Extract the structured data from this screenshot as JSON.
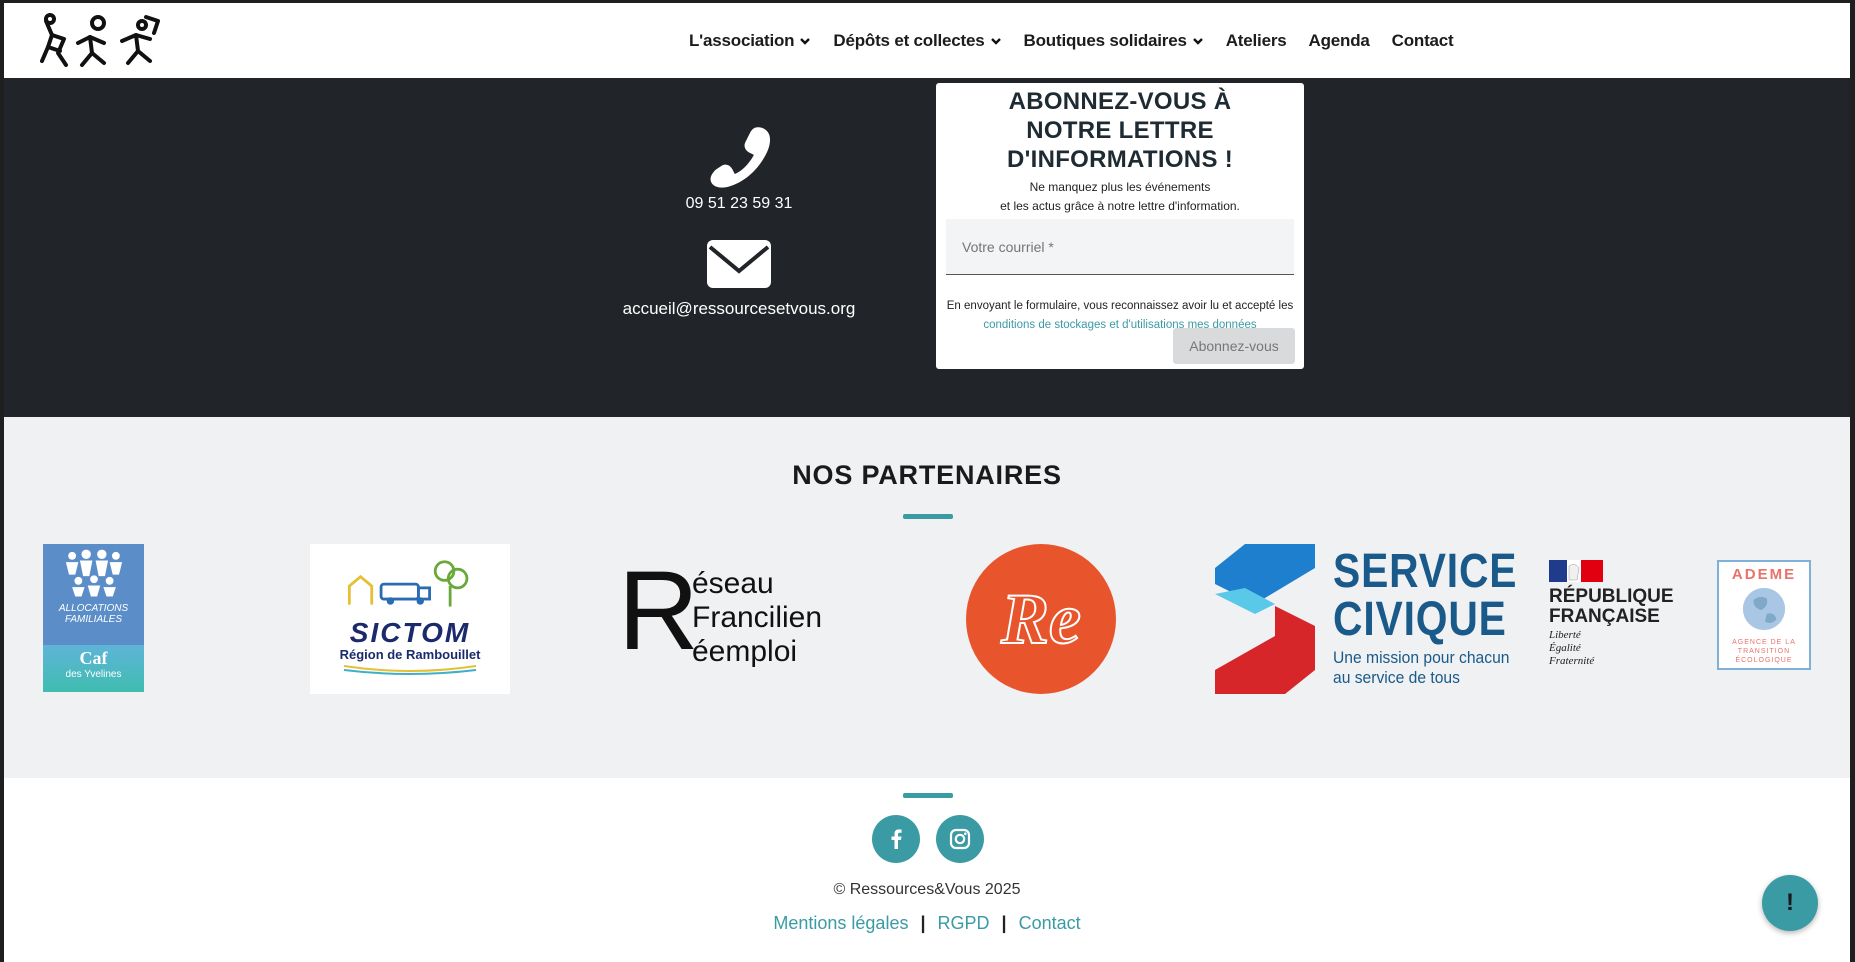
{
  "header": {
    "nav": [
      {
        "label": "L'association",
        "dropdown": true
      },
      {
        "label": "Dépôts et collectes",
        "dropdown": true
      },
      {
        "label": "Boutiques solidaires",
        "dropdown": true
      },
      {
        "label": "Ateliers",
        "dropdown": false
      },
      {
        "label": "Agenda",
        "dropdown": false
      },
      {
        "label": "Contact",
        "dropdown": false
      }
    ]
  },
  "contact": {
    "phone": "09 51 23 59 31",
    "email": "accueil@ressourcesetvous.org"
  },
  "newsletter": {
    "title": "ABONNEZ-VOUS À NOTRE LETTRE D'INFORMATIONS !",
    "subtitle_line1": "Ne manquez plus les événements",
    "subtitle_line2": "et les actus grâce à notre lettre d'information.",
    "email_placeholder": "Votre courriel *",
    "legal_text": "En envoyant le formulaire, vous reconnaissez avoir lu et accepté les",
    "legal_link": "conditions de stockages et d'utilisations mes données",
    "button": "Abonnez-vous"
  },
  "partners": {
    "title": "NOS PARTENAIRES",
    "logos": {
      "caf": {
        "line1": "ALLOCATIONS",
        "line2": "FAMILIALES",
        "line3": "Caf",
        "line4": "des Yvelines"
      },
      "sictom": {
        "name": "SICTOM",
        "sub": "Région de Rambouillet"
      },
      "reseau": {
        "r": "R",
        "l1": "éseau",
        "l2": "Francilien",
        "l3": "éemploi"
      },
      "re": {
        "text": "Re"
      },
      "service_civique": {
        "l1": "SERVICE",
        "l2": "CIVIQUE",
        "l3": "Une mission pour chacun",
        "l4": "au service de tous"
      },
      "republique": {
        "l1": "RÉPUBLIQUE",
        "l2": "FRANÇAISE",
        "m1": "Liberté",
        "m2": "Égalité",
        "m3": "Fraternité"
      },
      "ademe": {
        "name": "ADEME",
        "l1": "AGENCE DE LA",
        "l2": "TRANSITION",
        "l3": "ÉCOLOGIQUE"
      }
    }
  },
  "footer": {
    "copyright": "© Ressources&Vous 2025",
    "links": [
      "Mentions légales",
      "RGPD",
      "Contact"
    ]
  },
  "help_button": "!",
  "colors": {
    "accent": "#3a9ba5",
    "dark": "#212428",
    "caf_blue": "#5b8ec9",
    "caf_teal": "#3fbdb0",
    "re_orange": "#e8552d",
    "sc_blue": "#1a5a8a",
    "sc_red": "#d6262a"
  },
  "icons": [
    "phone-icon",
    "envelope-icon",
    "facebook-icon",
    "instagram-icon",
    "chevron-down-icon"
  ]
}
